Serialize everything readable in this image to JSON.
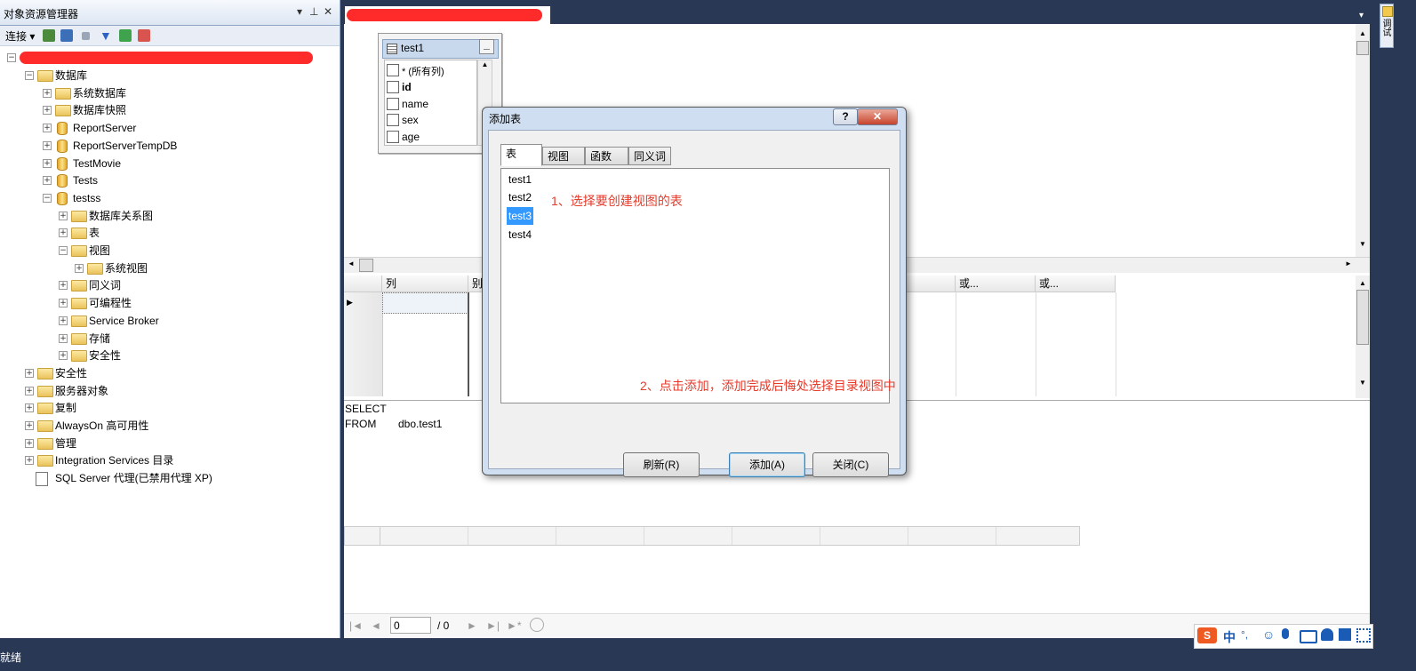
{
  "object_explorer": {
    "title": "对象资源管理器",
    "pin": "▾ ⊥ ✕",
    "toolbar": {
      "connect_label": "连接"
    },
    "tree": [
      {
        "label": "数据库",
        "level": 1,
        "expanded": true,
        "icon": "folder-icon"
      },
      {
        "label": "系统数据库",
        "level": 2,
        "expanded": false,
        "icon": "folder-icon"
      },
      {
        "label": "数据库快照",
        "level": 2,
        "expanded": false,
        "icon": "folder-icon"
      },
      {
        "label": "ReportServer",
        "level": 2,
        "expanded": false,
        "icon": "database-icon"
      },
      {
        "label": "ReportServerTempDB",
        "level": 2,
        "expanded": false,
        "icon": "database-icon"
      },
      {
        "label": "TestMovie",
        "level": 2,
        "expanded": false,
        "icon": "database-icon"
      },
      {
        "label": "Tests",
        "level": 2,
        "expanded": false,
        "icon": "database-icon"
      },
      {
        "label": "testss",
        "level": 2,
        "expanded": true,
        "icon": "database-icon"
      },
      {
        "label": "数据库关系图",
        "level": 3,
        "expanded": false,
        "icon": "folder-icon"
      },
      {
        "label": "表",
        "level": 3,
        "expanded": false,
        "icon": "folder-icon"
      },
      {
        "label": "视图",
        "level": 3,
        "expanded": true,
        "icon": "folder-icon"
      },
      {
        "label": "系统视图",
        "level": 4,
        "expanded": false,
        "icon": "folder-icon"
      },
      {
        "label": "同义词",
        "level": 3,
        "expanded": false,
        "icon": "folder-icon"
      },
      {
        "label": "可编程性",
        "level": 3,
        "expanded": false,
        "icon": "folder-icon"
      },
      {
        "label": "Service Broker",
        "level": 3,
        "expanded": false,
        "icon": "folder-icon"
      },
      {
        "label": "存储",
        "level": 3,
        "expanded": false,
        "icon": "folder-icon"
      },
      {
        "label": "安全性",
        "level": 3,
        "expanded": false,
        "icon": "folder-icon"
      },
      {
        "label": "安全性",
        "level": 1,
        "expanded": false,
        "icon": "folder-icon"
      },
      {
        "label": "服务器对象",
        "level": 1,
        "expanded": false,
        "icon": "folder-icon"
      },
      {
        "label": "复制",
        "level": 1,
        "expanded": false,
        "icon": "folder-icon"
      },
      {
        "label": "AlwaysOn 高可用性",
        "level": 1,
        "expanded": false,
        "icon": "folder-icon"
      },
      {
        "label": "管理",
        "level": 1,
        "expanded": false,
        "icon": "folder-icon"
      },
      {
        "label": "Integration Services 目录",
        "level": 1,
        "expanded": false,
        "icon": "folder-icon"
      },
      {
        "label": "SQL Server 代理(已禁用代理 XP)",
        "level": 1,
        "expanded": null,
        "icon": "agent-icon"
      }
    ]
  },
  "diagram_table": {
    "name": "test1",
    "minimize": "_",
    "columns": [
      {
        "label": "* (所有列)",
        "bold": false
      },
      {
        "label": "id",
        "bold": true
      },
      {
        "label": "name",
        "bold": false
      },
      {
        "label": "sex",
        "bold": false
      },
      {
        "label": "age",
        "bold": false
      }
    ]
  },
  "criteria_grid": {
    "headers": [
      "列",
      "别",
      "或...",
      "或..."
    ]
  },
  "sql_pane": {
    "line1": "SELECT",
    "line2_kw": "FROM",
    "line2_val": "dbo.test1"
  },
  "navbar": {
    "page_value": "0",
    "page_total": "/ 0"
  },
  "status_bar": {
    "text": "就绪"
  },
  "right_strip": {
    "label": "调试"
  },
  "ime": {
    "logo": "S",
    "mode": "中"
  },
  "dialog": {
    "title": "添加表",
    "help_label": "?",
    "close_label": "✕",
    "tabs": [
      "表",
      "视图",
      "函数",
      "同义词"
    ],
    "active_tab": 0,
    "tables": [
      "test1",
      "test2",
      "test3",
      "test4"
    ],
    "selected_table": "test3",
    "note1": "1、选择要创建视图的表",
    "note2": "2、点击添加，添加完成后悔处选择目录视图中",
    "buttons": {
      "refresh": "刷新(R)",
      "add": "添加(A)",
      "close": "关闭(C)"
    }
  },
  "colors": {
    "selection": "#3399ff",
    "annotation": "#e53b2c",
    "frame": "#293955"
  }
}
